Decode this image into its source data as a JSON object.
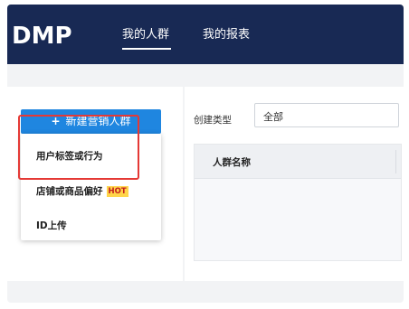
{
  "header": {
    "logo": "DMP",
    "tabs": [
      {
        "label": "我的人群",
        "active": true
      },
      {
        "label": "我的报表",
        "active": false
      }
    ]
  },
  "sidebar": {
    "new_button_icon": "plus-icon",
    "new_button_label": "新建营销人群",
    "menu": {
      "items": [
        {
          "label": "用户标签或行为"
        },
        {
          "label": "店铺或商品偏好",
          "badge": "HOT"
        },
        {
          "label": "ID上传"
        }
      ]
    }
  },
  "main": {
    "filter": {
      "label": "创建类型",
      "value": "全部"
    },
    "table": {
      "columns": [
        "人群名称"
      ]
    }
  },
  "colors": {
    "navbar": "#182954",
    "primary_button": "#1f86e0",
    "highlight": "#e53935",
    "hot_badge_bg": "#ffd54a"
  }
}
